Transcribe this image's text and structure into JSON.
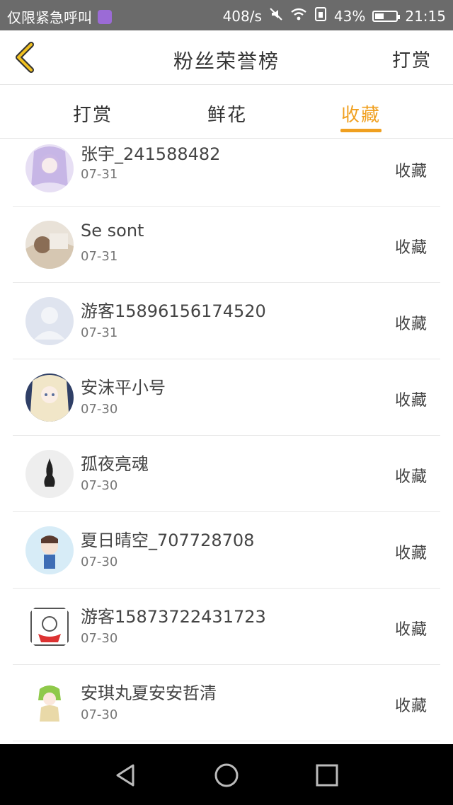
{
  "status": {
    "carrier": "仅限紧急呼叫",
    "speed": "408/s",
    "battery": "43%",
    "battery_level": 0.43,
    "time": "21:15"
  },
  "nav": {
    "title": "粉丝荣誉榜",
    "right_label": "打赏"
  },
  "tabs": {
    "items": [
      "打赏",
      "鲜花",
      "收藏"
    ],
    "active_index": 2,
    "accent": "#f0a020"
  },
  "list": [
    {
      "name": "张宇_241588482",
      "date": "07-31",
      "action": "收藏",
      "avatar": "purple-haired-girl"
    },
    {
      "name": "Se sont",
      "date": "07-31",
      "action": "收藏",
      "avatar": "sleeping-person"
    },
    {
      "name": "游客15896156174520",
      "date": "07-31",
      "action": "收藏",
      "avatar": "default-user"
    },
    {
      "name": "安沫平小号",
      "date": "07-30",
      "action": "收藏",
      "avatar": "anime-girl"
    },
    {
      "name": "孤夜亮魂",
      "date": "07-30",
      "action": "收藏",
      "avatar": "black-cat"
    },
    {
      "name": "夏日晴空_707728708",
      "date": "07-30",
      "action": "收藏",
      "avatar": "chibi-boy"
    },
    {
      "name": "游客15873722431723",
      "date": "07-30",
      "action": "收藏",
      "avatar": "sketch-character"
    },
    {
      "name": "安琪丸夏安安哲清",
      "date": "07-30",
      "action": "收藏",
      "avatar": "green-hair-girl"
    }
  ]
}
